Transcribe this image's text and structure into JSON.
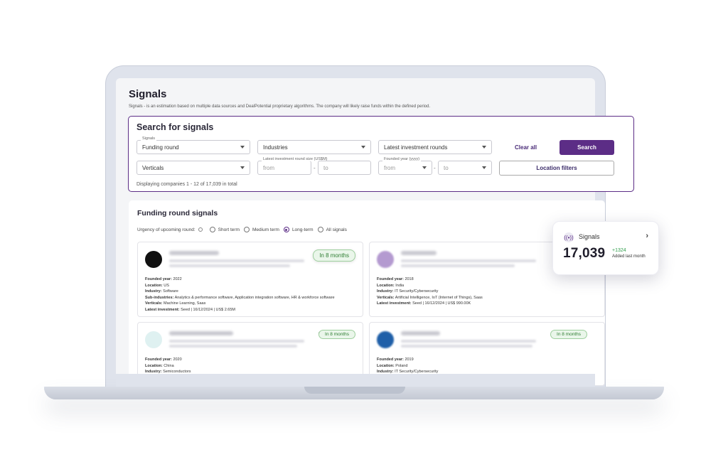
{
  "page": {
    "title": "Signals",
    "description": "Signals - is an estimation based on multiple data sources and DealPotential proprietary algorithms. The company will likely raise funds within the defined period."
  },
  "search": {
    "title": "Search for signals",
    "signals_label": "Signals",
    "signals_value": "Funding round",
    "industries_placeholder": "Industries",
    "rounds_placeholder": "Latest investment rounds",
    "clear_label": "Clear all",
    "search_label": "Search",
    "verticals_placeholder": "Verticals",
    "round_size_label": "Latest investment round size (US$M)",
    "round_size_from": "from",
    "round_size_to": "to",
    "founded_label": "Founded year (yyyy)",
    "founded_from": "from",
    "founded_to": "to",
    "location_label": "Location filters",
    "dash": "-",
    "count_text": "Displaying companies 1 - 12 of 17,039 in total"
  },
  "results": {
    "title": "Funding round signals",
    "urgency_label": "Urgency of upcoming round:",
    "options": [
      "Short term",
      "Medium term",
      "Long-term",
      "All signals"
    ],
    "selected": "Long-term",
    "companies": [
      {
        "badge": "In 8 months",
        "logo_color": "#111111",
        "founded_label": "Founded year:",
        "founded": "2022",
        "location_label": "Location:",
        "location": "US",
        "industry_label": "Industry:",
        "industry": "Software",
        "sub_label": "Sub-industries:",
        "sub": "Analytics & performance software, Application integration software, HR & workforce software",
        "verticals_label": "Verticals:",
        "verticals": "Machine Learning, Saas",
        "investment_label": "Latest investment:",
        "investment": "Seed | 16/12/2024 | US$ 2.65M"
      },
      {
        "badge": "",
        "logo_color": "#b49ad0",
        "founded_label": "Founded year:",
        "founded": "2018",
        "location_label": "Location:",
        "location": "India",
        "industry_label": "Industry:",
        "industry": "IT Security/Cybersecurity",
        "verticals_label": "Verticals:",
        "verticals": "Artificial Intelligence, IoT (Internet of Things), Saas",
        "investment_label": "Latest investment:",
        "investment": "Seed | 16/12/2024 | US$ 990.00K"
      },
      {
        "badge": "In 8 months",
        "logo_color": "#9fd7d7",
        "founded_label": "Founded year:",
        "founded": "2020",
        "location_label": "Location:",
        "location": "China",
        "industry_label": "Industry:",
        "industry": "Semiconductors"
      },
      {
        "badge": "In 8 months",
        "logo_color": "#1f5fa8",
        "founded_label": "Founded year:",
        "founded": "2019",
        "location_label": "Location:",
        "location": "Poland",
        "industry_label": "Industry:",
        "industry": "IT Security/Cybersecurity"
      }
    ]
  },
  "widget": {
    "label": "Signals",
    "value": "17,039",
    "delta": "+1324",
    "caption": "Added last month",
    "chevron": "›"
  },
  "colors": {
    "accent": "#5c2d86",
    "success": "#2e7d32"
  }
}
